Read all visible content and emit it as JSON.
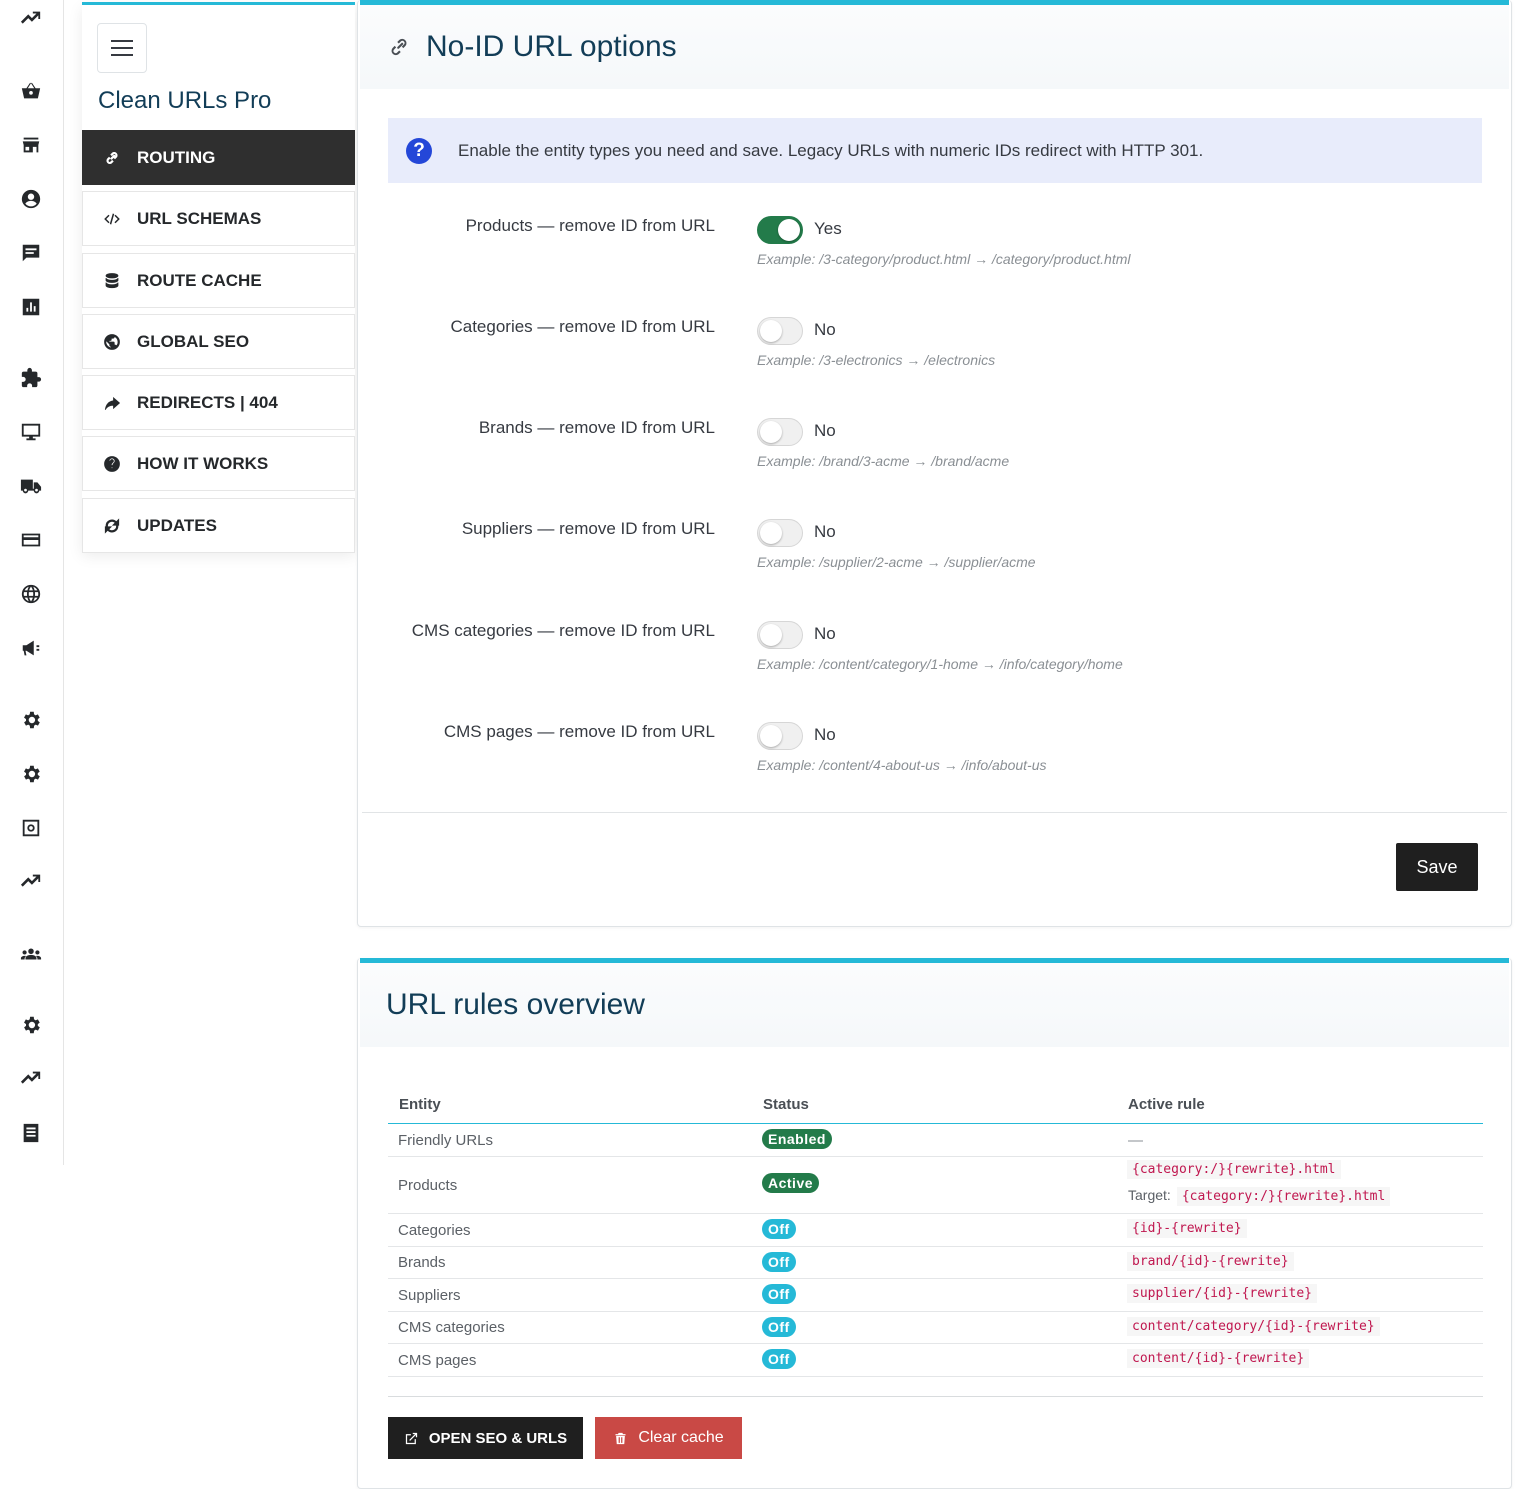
{
  "sidebar_rail": {
    "icons": [
      "trending-up-icon",
      "basket-icon",
      "store-icon",
      "user-circle-icon",
      "chat-icon",
      "bar-chart-icon",
      "puzzle-icon",
      "monitor-icon",
      "truck-icon",
      "credit-card-icon",
      "globe-icon",
      "megaphone-icon",
      "settings-icon",
      "settings-icon",
      "settings-box-icon",
      "trending-up-icon",
      "team-icon",
      "settings-icon",
      "trending-up-icon",
      "receipt-icon"
    ]
  },
  "module": {
    "title": "Clean URLs Pro",
    "menu": [
      {
        "label": "ROUTING",
        "icon": "link-icon",
        "active": true
      },
      {
        "label": "URL SCHEMAS",
        "icon": "code-icon",
        "active": false
      },
      {
        "label": "ROUTE CACHE",
        "icon": "database-icon",
        "active": false
      },
      {
        "label": "GLOBAL SEO",
        "icon": "globe-icon",
        "active": false
      },
      {
        "label": "REDIRECTS | 404",
        "icon": "share-arrow-icon",
        "active": false
      },
      {
        "label": "HOW IT WORKS",
        "icon": "question-icon",
        "active": false
      },
      {
        "label": "UPDATES",
        "icon": "refresh-icon",
        "active": false
      }
    ]
  },
  "options_panel": {
    "title": "No-ID URL options",
    "info": "Enable the entity types you need and save. Legacy URLs with numeric IDs redirect with HTTP 301.",
    "fields": [
      {
        "label": "Products — remove ID from URL",
        "enabled": true,
        "value": "Yes",
        "example": "Example: /3-category/product.html → /category/product.html"
      },
      {
        "label": "Categories — remove ID from URL",
        "enabled": false,
        "value": "No",
        "example": "Example: /3-electronics → /electronics"
      },
      {
        "label": "Brands — remove ID from URL",
        "enabled": false,
        "value": "No",
        "example": "Example: /brand/3-acme → /brand/acme"
      },
      {
        "label": "Suppliers — remove ID from URL",
        "enabled": false,
        "value": "No",
        "example": "Example: /supplier/2-acme → /supplier/acme"
      },
      {
        "label": "CMS categories — remove ID from URL",
        "enabled": false,
        "value": "No",
        "example": "Example: /content/category/1-home → /info/category/home"
      },
      {
        "label": "CMS pages — remove ID from URL",
        "enabled": false,
        "value": "No",
        "example": "Example: /content/4-about-us → /info/about-us"
      }
    ],
    "save_label": "Save"
  },
  "rules_panel": {
    "title": "URL rules overview",
    "columns": [
      "Entity",
      "Status",
      "Active rule"
    ],
    "rows": [
      {
        "entity": "Friendly URLs",
        "status": "Enabled",
        "status_color": "#237b4a",
        "rule": "—",
        "target_label": "",
        "target": ""
      },
      {
        "entity": "Products",
        "status": "Active",
        "status_color": "#237b4a",
        "rule": "{category:/}{rewrite}.html",
        "target_label": "Target:",
        "target": "{category:/}{rewrite}.html"
      },
      {
        "entity": "Categories",
        "status": "Off",
        "status_color": "#25b9d7",
        "rule": "{id}-{rewrite}",
        "target_label": "",
        "target": ""
      },
      {
        "entity": "Brands",
        "status": "Off",
        "status_color": "#25b9d7",
        "rule": "brand/{id}-{rewrite}",
        "target_label": "",
        "target": ""
      },
      {
        "entity": "Suppliers",
        "status": "Off",
        "status_color": "#25b9d7",
        "rule": "supplier/{id}-{rewrite}",
        "target_label": "",
        "target": ""
      },
      {
        "entity": "CMS categories",
        "status": "Off",
        "status_color": "#25b9d7",
        "rule": "content/category/{id}-{rewrite}",
        "target_label": "",
        "target": ""
      },
      {
        "entity": "CMS pages",
        "status": "Off",
        "status_color": "#25b9d7",
        "rule": "content/{id}-{rewrite}",
        "target_label": "",
        "target": ""
      }
    ],
    "open_button": "OPEN SEO & URLS",
    "clear_button": "Clear cache"
  },
  "colors": {
    "accent": "#25b9d7",
    "success": "#237b4a",
    "danger": "#c94945",
    "dark": "#1f1f1f"
  }
}
